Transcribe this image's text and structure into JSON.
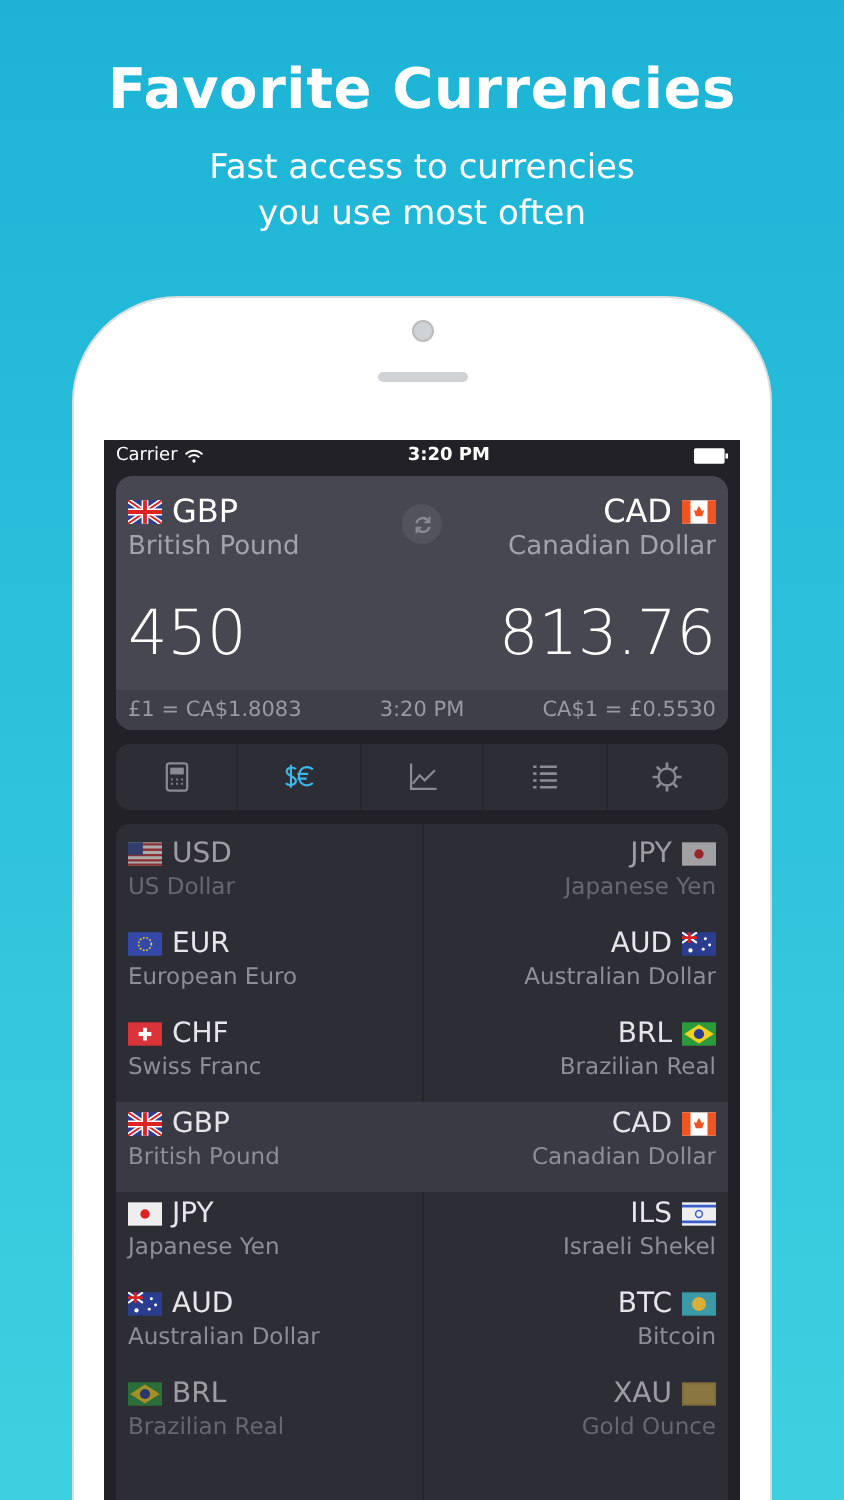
{
  "headline": "Favorite Currencies",
  "subtitle": "Fast access to currencies you use most often",
  "status_bar": {
    "carrier": "Carrier",
    "time": "3:20 PM"
  },
  "converter": {
    "from": {
      "code": "GBP",
      "name": "British Pound",
      "kind": "gb",
      "amount": "450"
    },
    "to": {
      "code": "CAD",
      "name": "Canadian Dollar",
      "kind": "ca",
      "amount": "813.76"
    },
    "rate_from": "£1 = CA$1.8083",
    "time": "3:20 PM",
    "rate_to": "CA$1 = £0.5530"
  },
  "tabs": [
    {
      "kind": "calculator",
      "selected": false
    },
    {
      "kind": "currencies",
      "selected": true
    },
    {
      "kind": "chart",
      "selected": false
    },
    {
      "kind": "list",
      "selected": false
    },
    {
      "kind": "settings",
      "selected": false
    }
  ],
  "rows": [
    {
      "selected": false,
      "dimmed": true,
      "left": {
        "code": "USD",
        "name": "US Dollar",
        "kind": "us"
      },
      "right": {
        "code": "JPY",
        "name": "Japanese Yen",
        "kind": "jp"
      }
    },
    {
      "selected": false,
      "dimmed": false,
      "left": {
        "code": "EUR",
        "name": "European Euro",
        "kind": "eu"
      },
      "right": {
        "code": "AUD",
        "name": "Australian Dollar",
        "kind": "au"
      }
    },
    {
      "selected": false,
      "dimmed": false,
      "left": {
        "code": "CHF",
        "name": "Swiss Franc",
        "kind": "ch"
      },
      "right": {
        "code": "BRL",
        "name": "Brazilian Real",
        "kind": "br"
      }
    },
    {
      "selected": true,
      "dimmed": false,
      "left": {
        "code": "GBP",
        "name": "British Pound",
        "kind": "gb"
      },
      "right": {
        "code": "CAD",
        "name": "Canadian Dollar",
        "kind": "ca"
      }
    },
    {
      "selected": false,
      "dimmed": false,
      "left": {
        "code": "JPY",
        "name": "Japanese Yen",
        "kind": "jp"
      },
      "right": {
        "code": "ILS",
        "name": "Israeli Shekel",
        "kind": "il"
      }
    },
    {
      "selected": false,
      "dimmed": false,
      "left": {
        "code": "AUD",
        "name": "Australian Dollar",
        "kind": "au"
      },
      "right": {
        "code": "BTC",
        "name": "Bitcoin",
        "kind": "btc"
      }
    },
    {
      "selected": false,
      "dimmed": true,
      "left": {
        "code": "BRL",
        "name": "Brazilian Real",
        "kind": "br"
      },
      "right": {
        "code": "XAU",
        "name": "Gold Ounce",
        "kind": "xau"
      }
    }
  ]
}
